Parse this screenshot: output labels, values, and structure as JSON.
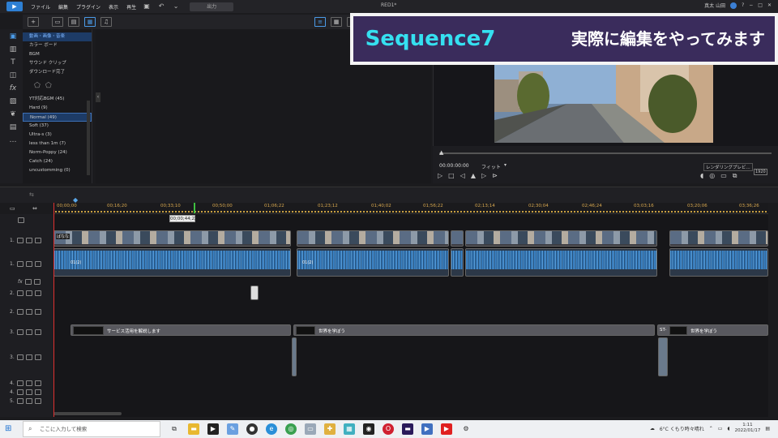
{
  "app": {
    "menu": [
      "ファイル",
      "編集",
      "プラグイン",
      "表示",
      "再生"
    ],
    "output_button": "出力",
    "project_title": "RED1*",
    "user": "真太 山田"
  },
  "categories": [
    "動画・画像・音楽",
    "カラー ボード",
    "BGM",
    "サウンド クリップ",
    "ダウンロード完了"
  ],
  "subcategories": [
    "YT対応BGM (45)",
    "Hard (9)",
    "Normal (49)",
    "Soft (37)",
    "Ultra-s (3)",
    "less than 1m (7)",
    "Norm-Poppy (24)",
    "Catch (24)",
    "uncustomming (0)"
  ],
  "banner": {
    "sequence": "Sequence7",
    "caption": "実際に編集をやってみます"
  },
  "preview": {
    "timecode": "00:00:00:00",
    "fit": "フィット",
    "render_button": "レンダリングプレビ...",
    "quality": "1920"
  },
  "timeline": {
    "ruler": [
      "00;00;00",
      "00;16;20",
      "00;33;10",
      "00;50;00",
      "01;06;22",
      "01;23;12",
      "01;40;02",
      "01;56;22",
      "02;13;14",
      "02;30;04",
      "02;46;24",
      "03;03;16",
      "03;20;06",
      "03;36;26"
    ],
    "playhead_tc": "00;00;44;22",
    "tracks": [
      "1.",
      "1.",
      "fx",
      "2.",
      "2.",
      "3.",
      "3.",
      "4.",
      "4.",
      "5."
    ],
    "clip_labels": [
      "ばなな",
      "01(2)",
      "01(2)"
    ],
    "titles": [
      "ST-",
      "サービス活用を解説します",
      "世界を学ぼう",
      "世界を学ぼう"
    ]
  },
  "taskbar": {
    "search_placeholder": "ここに入力して検索",
    "weather": "6°C くもり時々晴れ",
    "time": "1:11",
    "date": "2022/01/17"
  }
}
